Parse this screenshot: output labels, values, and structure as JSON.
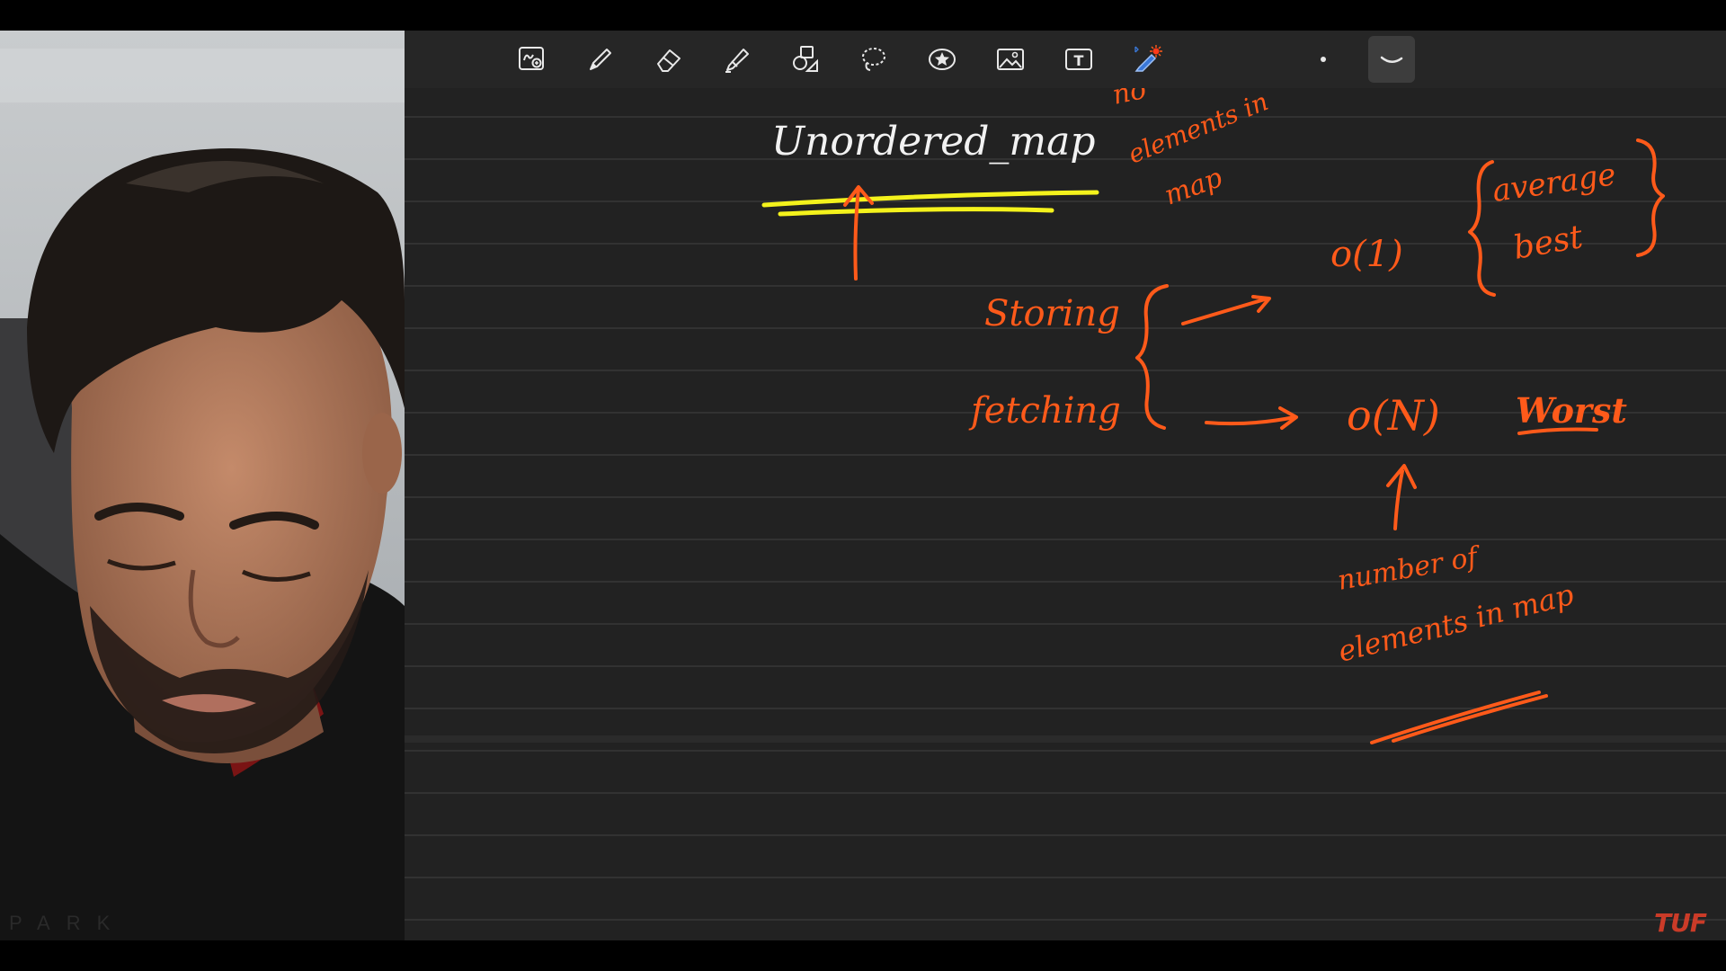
{
  "toolbar": {
    "tools": [
      {
        "name": "zoom-window-tool",
        "label": "Zoom window"
      },
      {
        "name": "pen-tool",
        "label": "Pen"
      },
      {
        "name": "eraser-tool",
        "label": "Eraser"
      },
      {
        "name": "highlighter-tool",
        "label": "Highlighter"
      },
      {
        "name": "shapes-tool",
        "label": "Shapes"
      },
      {
        "name": "lasso-tool",
        "label": "Lasso"
      },
      {
        "name": "sticker-tool",
        "label": "Elements"
      },
      {
        "name": "image-tool",
        "label": "Image"
      },
      {
        "name": "text-tool",
        "label": "Text"
      },
      {
        "name": "laser-pointer-tool",
        "label": "Laser pointer"
      }
    ],
    "text_tool_glyph": "T",
    "selected_tool": "laser-pointer-tool",
    "accent_color": "#ff5a1a"
  },
  "notes": {
    "title": "Unordered_map",
    "top_fragment_1": "no",
    "top_fragment_2": "elements in",
    "top_fragment_3": "map",
    "left_label_1": "Storing",
    "left_label_2": "fetching",
    "complexity_best": "o(1)",
    "complexity_worst": "o(N)",
    "case_1": "average",
    "case_2": "best",
    "case_3": "Worst",
    "note_line_1": "number of",
    "note_line_2": "elements in map",
    "ink_color": "#ff5a1a",
    "highlight_color": "#f4f21c",
    "title_color": "#f2f2f2"
  },
  "watermark": {
    "text": "TUF"
  }
}
